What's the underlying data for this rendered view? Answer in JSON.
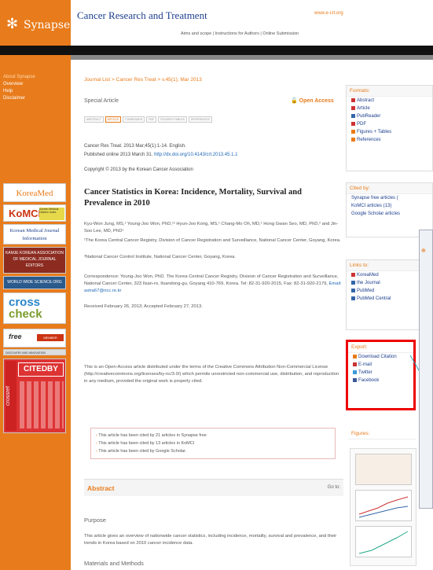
{
  "header": {
    "brand": "Synapse",
    "journal_title": "Cancer Research and Treatment",
    "journal_url": "www.e-crt.org",
    "links": "Aims and scope  |  Instructions for Authors  |  Online Submission"
  },
  "sidebar": {
    "nav": [
      "About Synapse",
      "Overview",
      "Help",
      "Disclaimer"
    ],
    "badges": {
      "koreamed": "KoreaMed",
      "kmci": "KoMCI",
      "kmci_sub": "Korean Medical Citation Index",
      "kmji": "Korean Medical Journal Information",
      "kamje": "KAMJE KOREAN ASSOCIATION OF MEDICAL JOURNAL EDITORS",
      "wpr": "WORLD WIDE SCIENCE.ORG",
      "crosscheck_1": "cross",
      "crosscheck_2": "check",
      "free": "free",
      "member": "MEMBER",
      "discovery": "DISCOVERY AND INNOVATION",
      "crossref": "crossref",
      "citedby": "CITEDBY"
    }
  },
  "main": {
    "breadcrumb": "Journal List > Cancer Res Treat > v.45(1); Mar 2013",
    "article_type": "Special Article",
    "open_access": "Open Access",
    "tabs": [
      "ABSTRACT",
      "ARTICLE",
      "PUBREADER",
      "PDF",
      "FIGURES+TABLES",
      "REFERENCES"
    ],
    "citation": "Cancer Res Treat. 2013 Mar;45(1):1-14. English.",
    "published": "Published online 2013 March 31.",
    "doi": "http://dx.doi.org/10.4143/crt.2013.45.1.1",
    "copyright": "Copyright © 2013 by the Korean Cancer Association",
    "title": "Cancer Statistics in Korea: Incidence, Mortality, Survival and Prevalence in 2010",
    "authors": "Kyu-Won Jung, MS,¹ Young-Joo Won, PhD,¹² Hyun-Joo Kong, MS,¹ Chang-Mo Oh, MD,¹ Hong Gwan Seo, MD, PhD,² and Jin-Soo Lee, MD, PhD¹",
    "affiliation_1": "¹The Korea Central Cancer Registry, Division of Cancer Registration and Surveillance, National Cancer Center, Goyang, Korea.",
    "affiliation_2": "²National Cancer Control Institute, National Cancer Center, Goyang, Korea.",
    "correspondence": "Correspondence: Young-Joo Won, PhD. The Korea Central Cancer Registry, Division of Cancer Registration and Surveillance, National Cancer Center, 323 Ilsan-ro, Ilsandong-gu, Goyang 410-769, Korea. Tel: 82-31-920-2015, Fax: 82-31-920-2179,",
    "email": "Email: astra67@ncc.re.kr",
    "received": "Received February 26, 2013; Accepted February 27, 2013.",
    "license": "This is an Open-Access article distributed under the terms of the Creative Commons Attribution Non-Commercial License (http://creativecommons.org/licenses/by-nc/3.0/) which permits unrestricted non-commercial use, distribution, and reproduction in any medium, provided the original work is properly cited.",
    "cited_lines": [
      "This article has been cited by 21 articles in Synapse free",
      "This article has been cited by 13 articles in KoMCI",
      "This article has been cited by Google Scholar."
    ],
    "abstract_label": "Abstract",
    "goto": "Go to:",
    "purpose_head": "Purpose",
    "purpose_text": "This article gives an overview of nationwide cancer statistics, including incidence, mortality, survival and prevalence, and their trends in Korea based on 2010 cancer incidence data.",
    "methods_head": "Materials and Methods"
  },
  "right": {
    "formats_head": "Formats:",
    "formats": [
      "Abstract",
      "Article",
      "PubReader",
      "PDF",
      "Figures + Tables",
      "References"
    ],
    "citedby_head": "Cited by:",
    "citedby_items": [
      "Synapse free articles (",
      "KoMCI articles (13)",
      "Google Scholar articles"
    ],
    "links_head": "Links to:",
    "links": [
      "KoreaMed",
      "the Journal",
      "PubMed",
      "PubMed Central"
    ],
    "export_head": "Export:",
    "export": [
      "Download Citation",
      "E-mail",
      "Twitter",
      "Facebook"
    ],
    "figures_head": "Figures:"
  },
  "colors": {
    "brand": "#e87b1b",
    "link": "#1c66b5",
    "highlight": "#e00000"
  }
}
